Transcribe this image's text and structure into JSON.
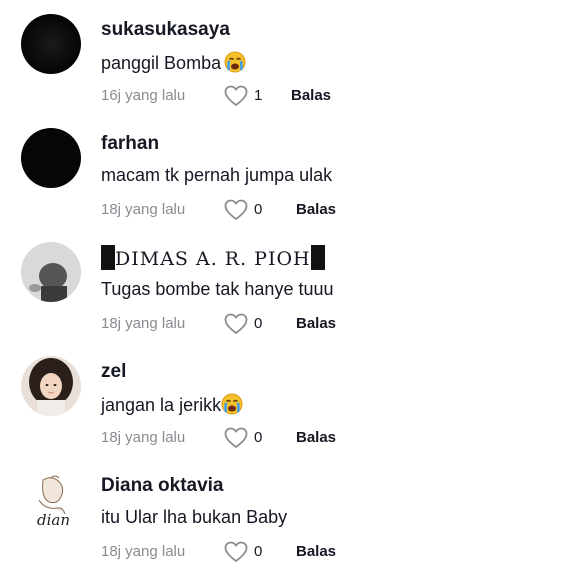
{
  "comments": [
    {
      "username": "sukasukasaya",
      "text": "panggil Bomba",
      "emoji": "crying-face-icon",
      "time": "16j yang lalu",
      "likes": "1",
      "reply_label": "Balas"
    },
    {
      "username": "farhan",
      "text": "macam tk pernah jumpa ulak",
      "time": "18j yang lalu",
      "likes": "0",
      "reply_label": "Balas"
    },
    {
      "username": "DIMAS A. R. PIOH",
      "text": "Tugas bombe tak hanye tuuu",
      "time": "18j yang lalu",
      "likes": "0",
      "reply_label": "Balas"
    },
    {
      "username": "zel",
      "text": "jangan la jerikk",
      "emoji": "crying-face-icon",
      "time": "18j yang lalu",
      "likes": "0",
      "reply_label": "Balas"
    },
    {
      "username": "Diana oktavia",
      "text": "itu Ular lha bukan Baby",
      "time": "18j yang lalu",
      "likes": "0",
      "reply_label": "Balas"
    }
  ],
  "colors": {
    "username": "#161823",
    "meta": "#8a8b91",
    "heart_outline": "#8a8b91"
  },
  "avatar_signature": "dian"
}
